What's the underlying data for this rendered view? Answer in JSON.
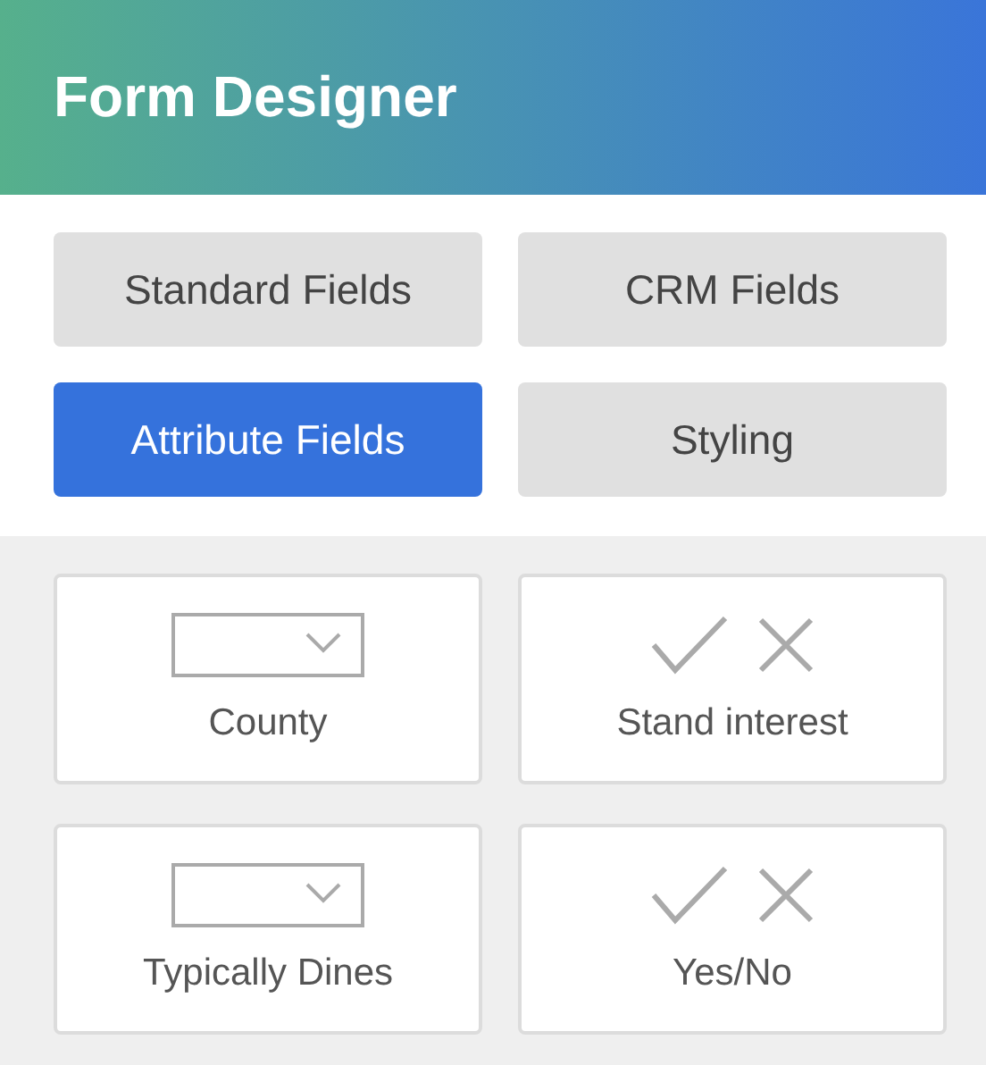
{
  "header": {
    "title": "Form Designer"
  },
  "tabs": [
    {
      "label": "Standard Fields",
      "selected": false
    },
    {
      "label": "CRM Fields",
      "selected": false
    },
    {
      "label": "Attribute Fields",
      "selected": true
    },
    {
      "label": "Styling",
      "selected": false
    }
  ],
  "fields": [
    {
      "label": "County",
      "kind": "dropdown"
    },
    {
      "label": "Stand interest",
      "kind": "boolean"
    },
    {
      "label": "Typically Dines",
      "kind": "dropdown"
    },
    {
      "label": "Yes/No",
      "kind": "boolean"
    }
  ]
}
